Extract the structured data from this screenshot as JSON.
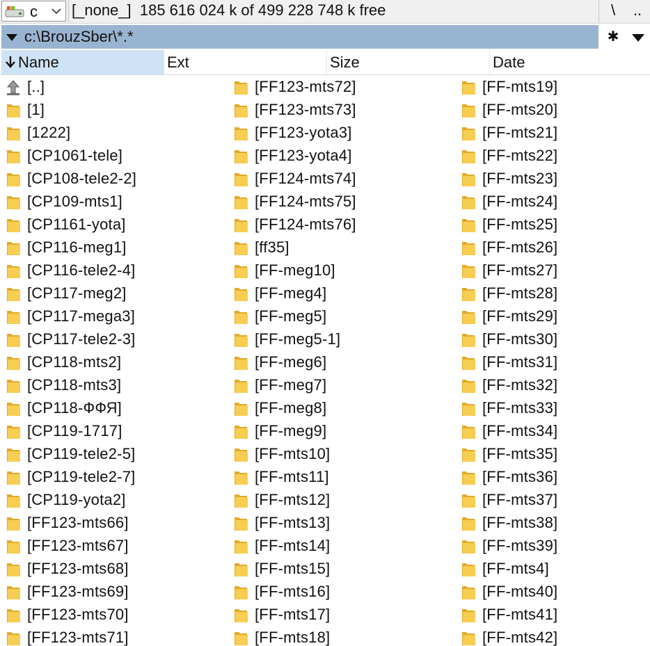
{
  "drivebar": {
    "drive_letter": "c",
    "free_space": "[_none_]  185 616 024 k of 499 228 748 k free",
    "root_label": "\\",
    "up_label": ".."
  },
  "pathbar": {
    "path": "c:\\BrouzSber\\*.*",
    "star_label": "✱"
  },
  "headers": {
    "name": "Name",
    "ext": "Ext",
    "size": "Size",
    "date": "Date"
  },
  "colors": {
    "accent": "#99b4d1",
    "header_active": "#cfe3f7",
    "folder": "#f5c542"
  },
  "columns": [
    [
      {
        "label": "[..]",
        "icon": "up-folder-icon"
      },
      {
        "label": "[1]",
        "icon": "folder-icon"
      },
      {
        "label": "[1222]",
        "icon": "folder-icon"
      },
      {
        "label": "[CP1061-tele]",
        "icon": "folder-icon"
      },
      {
        "label": "[CP108-tele2-2]",
        "icon": "folder-icon"
      },
      {
        "label": "[CP109-mts1]",
        "icon": "folder-icon"
      },
      {
        "label": "[CP1161-yota]",
        "icon": "folder-icon"
      },
      {
        "label": "[CP116-meg1]",
        "icon": "folder-icon"
      },
      {
        "label": "[CP116-tele2-4]",
        "icon": "folder-icon"
      },
      {
        "label": "[CP117-meg2]",
        "icon": "folder-icon"
      },
      {
        "label": "[CP117-mega3]",
        "icon": "folder-icon"
      },
      {
        "label": "[CP117-tele2-3]",
        "icon": "folder-icon"
      },
      {
        "label": "[CP118-mts2]",
        "icon": "folder-icon"
      },
      {
        "label": "[CP118-mts3]",
        "icon": "folder-icon"
      },
      {
        "label": "[CP118-ФФЯ]",
        "icon": "folder-icon"
      },
      {
        "label": "[CP119-1717]",
        "icon": "folder-icon"
      },
      {
        "label": "[CP119-tele2-5]",
        "icon": "folder-icon"
      },
      {
        "label": "[CP119-tele2-7]",
        "icon": "folder-icon"
      },
      {
        "label": "[CP119-yota2]",
        "icon": "folder-icon"
      },
      {
        "label": "[FF123-mts66]",
        "icon": "folder-icon"
      },
      {
        "label": "[FF123-mts67]",
        "icon": "folder-icon"
      },
      {
        "label": "[FF123-mts68]",
        "icon": "folder-icon"
      },
      {
        "label": "[FF123-mts69]",
        "icon": "folder-icon"
      },
      {
        "label": "[FF123-mts70]",
        "icon": "folder-icon"
      },
      {
        "label": "[FF123-mts71]",
        "icon": "folder-icon"
      }
    ],
    [
      {
        "label": "[FF123-mts72]",
        "icon": "folder-icon"
      },
      {
        "label": "[FF123-mts73]",
        "icon": "folder-icon"
      },
      {
        "label": "[FF123-yota3]",
        "icon": "folder-icon"
      },
      {
        "label": "[FF123-yota4]",
        "icon": "folder-icon"
      },
      {
        "label": "[FF124-mts74]",
        "icon": "folder-icon"
      },
      {
        "label": "[FF124-mts75]",
        "icon": "folder-icon"
      },
      {
        "label": "[FF124-mts76]",
        "icon": "folder-icon"
      },
      {
        "label": "[ff35]",
        "icon": "folder-icon"
      },
      {
        "label": "[FF-meg10]",
        "icon": "folder-icon"
      },
      {
        "label": "[FF-meg4]",
        "icon": "folder-icon"
      },
      {
        "label": "[FF-meg5]",
        "icon": "folder-icon"
      },
      {
        "label": "[FF-meg5-1]",
        "icon": "folder-icon"
      },
      {
        "label": "[FF-meg6]",
        "icon": "folder-icon"
      },
      {
        "label": "[FF-meg7]",
        "icon": "folder-icon"
      },
      {
        "label": "[FF-meg8]",
        "icon": "folder-icon"
      },
      {
        "label": "[FF-meg9]",
        "icon": "folder-icon"
      },
      {
        "label": "[FF-mts10]",
        "icon": "folder-icon"
      },
      {
        "label": "[FF-mts11]",
        "icon": "folder-icon"
      },
      {
        "label": "[FF-mts12]",
        "icon": "folder-icon"
      },
      {
        "label": "[FF-mts13]",
        "icon": "folder-icon"
      },
      {
        "label": "[FF-mts14]",
        "icon": "folder-icon"
      },
      {
        "label": "[FF-mts15]",
        "icon": "folder-icon"
      },
      {
        "label": "[FF-mts16]",
        "icon": "folder-icon"
      },
      {
        "label": "[FF-mts17]",
        "icon": "folder-icon"
      },
      {
        "label": "[FF-mts18]",
        "icon": "folder-icon"
      }
    ],
    [
      {
        "label": "[FF-mts19]",
        "icon": "folder-icon"
      },
      {
        "label": "[FF-mts20]",
        "icon": "folder-icon"
      },
      {
        "label": "[FF-mts21]",
        "icon": "folder-icon"
      },
      {
        "label": "[FF-mts22]",
        "icon": "folder-icon"
      },
      {
        "label": "[FF-mts23]",
        "icon": "folder-icon"
      },
      {
        "label": "[FF-mts24]",
        "icon": "folder-icon"
      },
      {
        "label": "[FF-mts25]",
        "icon": "folder-icon"
      },
      {
        "label": "[FF-mts26]",
        "icon": "folder-icon"
      },
      {
        "label": "[FF-mts27]",
        "icon": "folder-icon"
      },
      {
        "label": "[FF-mts28]",
        "icon": "folder-icon"
      },
      {
        "label": "[FF-mts29]",
        "icon": "folder-icon"
      },
      {
        "label": "[FF-mts30]",
        "icon": "folder-icon"
      },
      {
        "label": "[FF-mts31]",
        "icon": "folder-icon"
      },
      {
        "label": "[FF-mts32]",
        "icon": "folder-icon"
      },
      {
        "label": "[FF-mts33]",
        "icon": "folder-icon"
      },
      {
        "label": "[FF-mts34]",
        "icon": "folder-icon"
      },
      {
        "label": "[FF-mts35]",
        "icon": "folder-icon"
      },
      {
        "label": "[FF-mts36]",
        "icon": "folder-icon"
      },
      {
        "label": "[FF-mts37]",
        "icon": "folder-icon"
      },
      {
        "label": "[FF-mts38]",
        "icon": "folder-icon"
      },
      {
        "label": "[FF-mts39]",
        "icon": "folder-icon"
      },
      {
        "label": "[FF-mts4]",
        "icon": "folder-icon"
      },
      {
        "label": "[FF-mts40]",
        "icon": "folder-icon"
      },
      {
        "label": "[FF-mts41]",
        "icon": "folder-icon"
      },
      {
        "label": "[FF-mts42]",
        "icon": "folder-icon"
      }
    ]
  ]
}
